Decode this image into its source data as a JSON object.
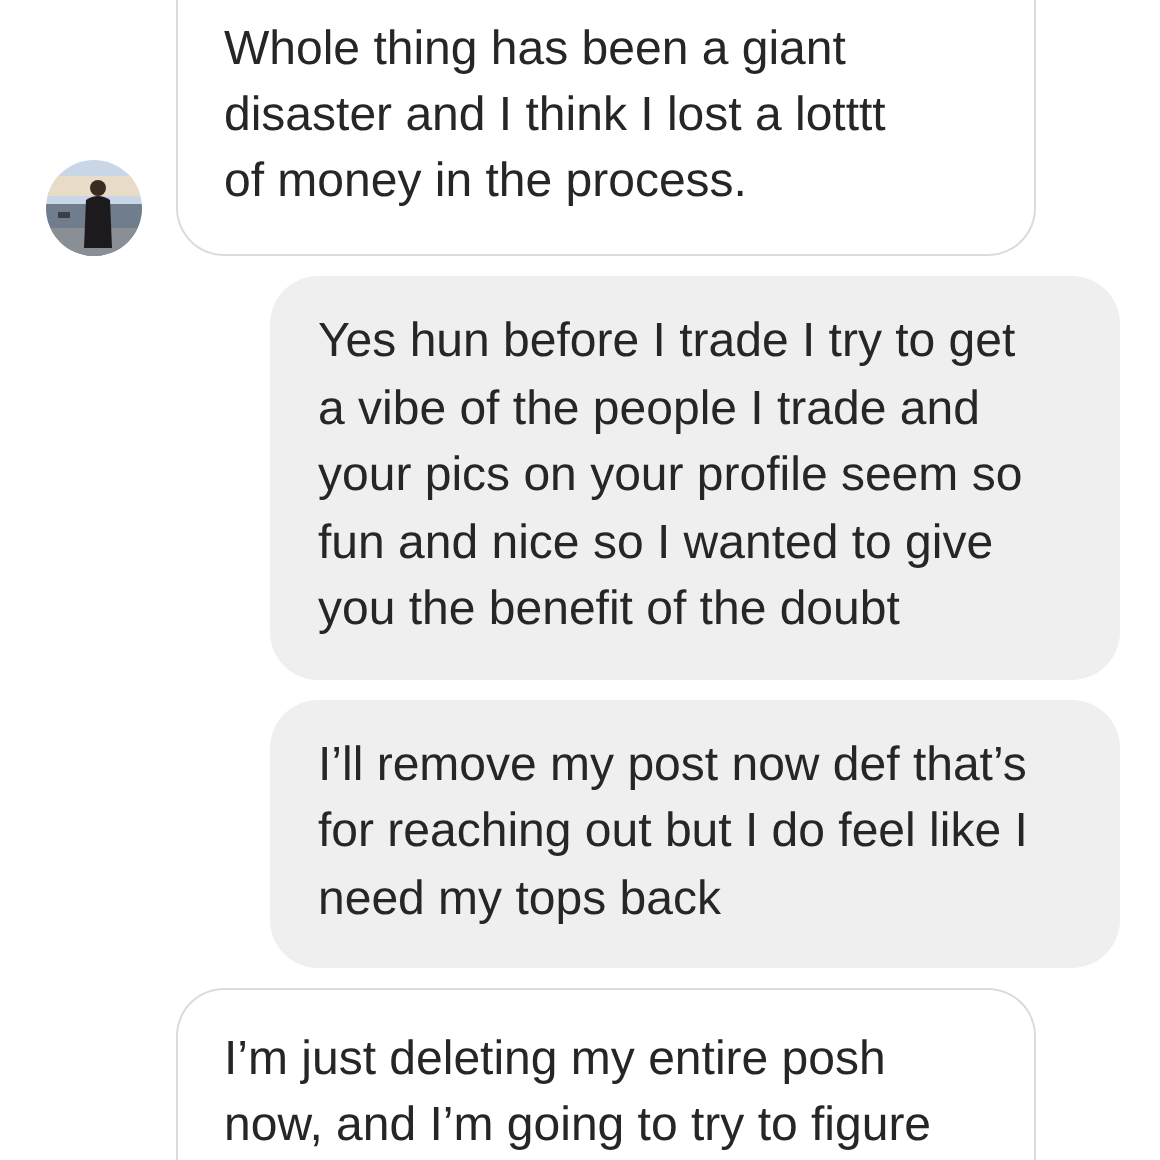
{
  "messages": [
    {
      "kind": "incoming",
      "text": "Whole thing has been a giant disaster and I think I lost a lotttt of money in the process.",
      "avatar": true
    },
    {
      "kind": "outgoing",
      "text": "Yes hun before I trade I try to get a vibe of the people I trade and your pics on your profile seem so fun and nice so I wanted to give you the benefit of the doubt"
    },
    {
      "kind": "outgoing",
      "text": "I’ll remove my post now def that’s for reaching out but I do feel like I need my tops back"
    },
    {
      "kind": "incoming",
      "text": "I’m just deleting my entire posh now, and I’m going to try to figure",
      "avatar": false
    }
  ]
}
